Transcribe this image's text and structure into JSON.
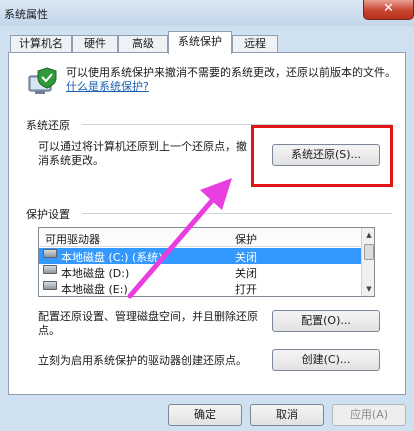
{
  "window": {
    "title": "系统属性",
    "close_glyph": "✕"
  },
  "tabs": [
    {
      "label": "计算机名",
      "active": false
    },
    {
      "label": "硬件",
      "active": false
    },
    {
      "label": "高级",
      "active": false
    },
    {
      "label": "系统保护",
      "active": true
    },
    {
      "label": "远程",
      "active": false
    }
  ],
  "intro": {
    "text": "可以使用系统保护来撤消不需要的系统更改，还原以前版本的文件。",
    "link": "什么是系统保护?"
  },
  "restore": {
    "group_label": "系统还原",
    "description": "可以通过将计算机还原到上一个还原点，撤消系统更改。",
    "button": "系统还原(S)..."
  },
  "protection": {
    "group_label": "保护设置",
    "columns": [
      "可用驱动器",
      "保护"
    ],
    "drives": [
      {
        "name": "本地磁盘 (C:) (系统)",
        "protection": "关闭",
        "selected": true
      },
      {
        "name": "本地磁盘 (D:)",
        "protection": "关闭",
        "selected": false
      },
      {
        "name": "本地磁盘 (E:)",
        "protection": "打开",
        "selected": false
      }
    ],
    "configure_text": "配置还原设置、管理磁盘空间，并且删除还原点。",
    "configure_button": "配置(O)...",
    "create_text": "立刻为启用系统保护的驱动器创建还原点。",
    "create_button": "创建(C)..."
  },
  "footer": {
    "ok": "确定",
    "cancel": "取消",
    "apply": "应用(A)"
  },
  "colors": {
    "highlight_box": "#e01515",
    "annotation_arrow": "#e83ee0",
    "selection": "#3399ff"
  }
}
